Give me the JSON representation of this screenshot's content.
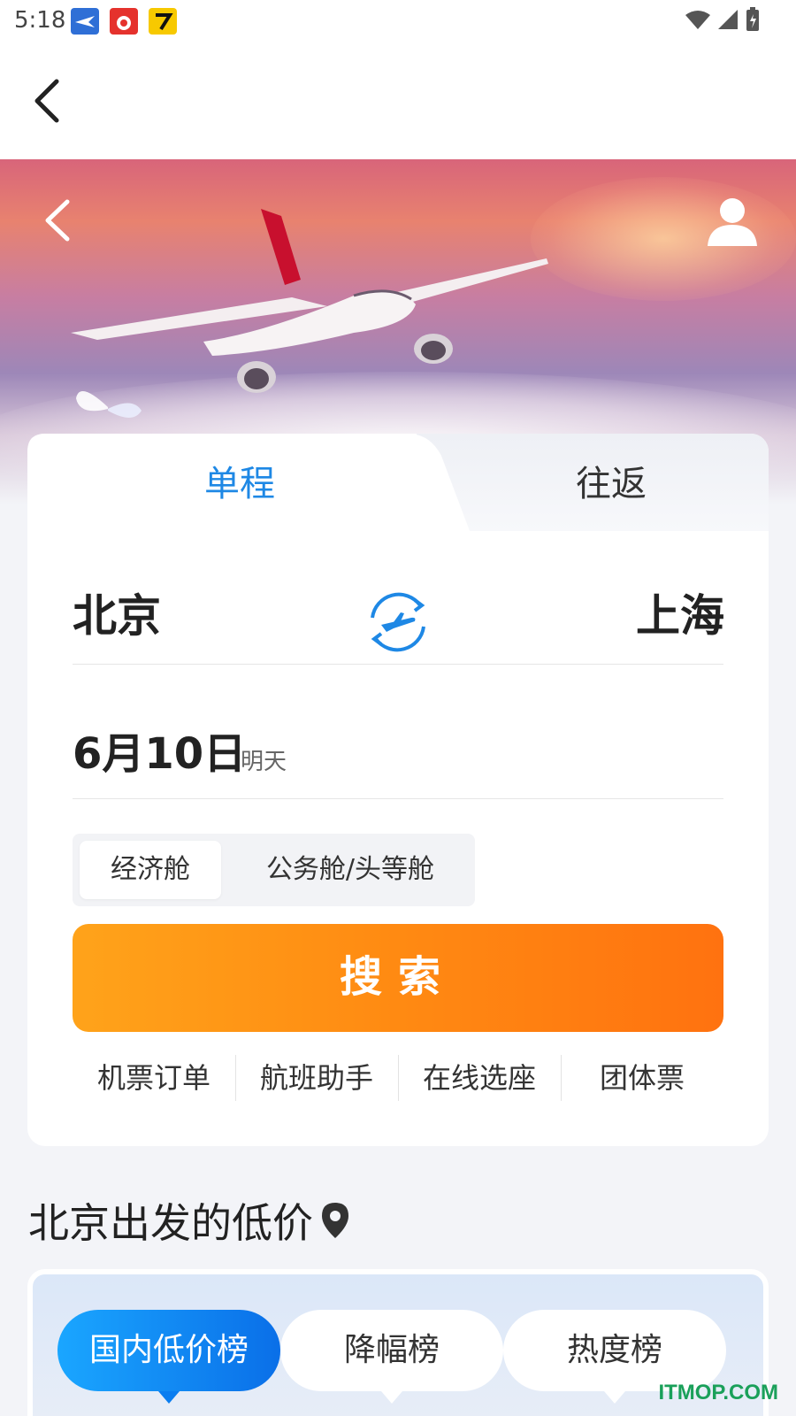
{
  "status_bar": {
    "time": "5:18"
  },
  "tabs": {
    "single": "单程",
    "round_trip": "往返"
  },
  "route": {
    "from": "北京",
    "to": "上海"
  },
  "date": {
    "main": "6月10日",
    "relative": "明天"
  },
  "cabin": {
    "economy": "经济舱",
    "business": "公务舱/头等舱"
  },
  "search_label": "搜索",
  "quick_links": [
    "机票订单",
    "航班助手",
    "在线选座",
    "团体票"
  ],
  "low_price": {
    "title": "北京出发的低价",
    "tabs": [
      "国内低价榜",
      "降幅榜",
      "热度榜"
    ]
  },
  "watermark": "ITMOP.COM",
  "colors": {
    "accent": "#1e88e5",
    "search_start": "#ffa31a",
    "search_end": "#ff7210"
  }
}
